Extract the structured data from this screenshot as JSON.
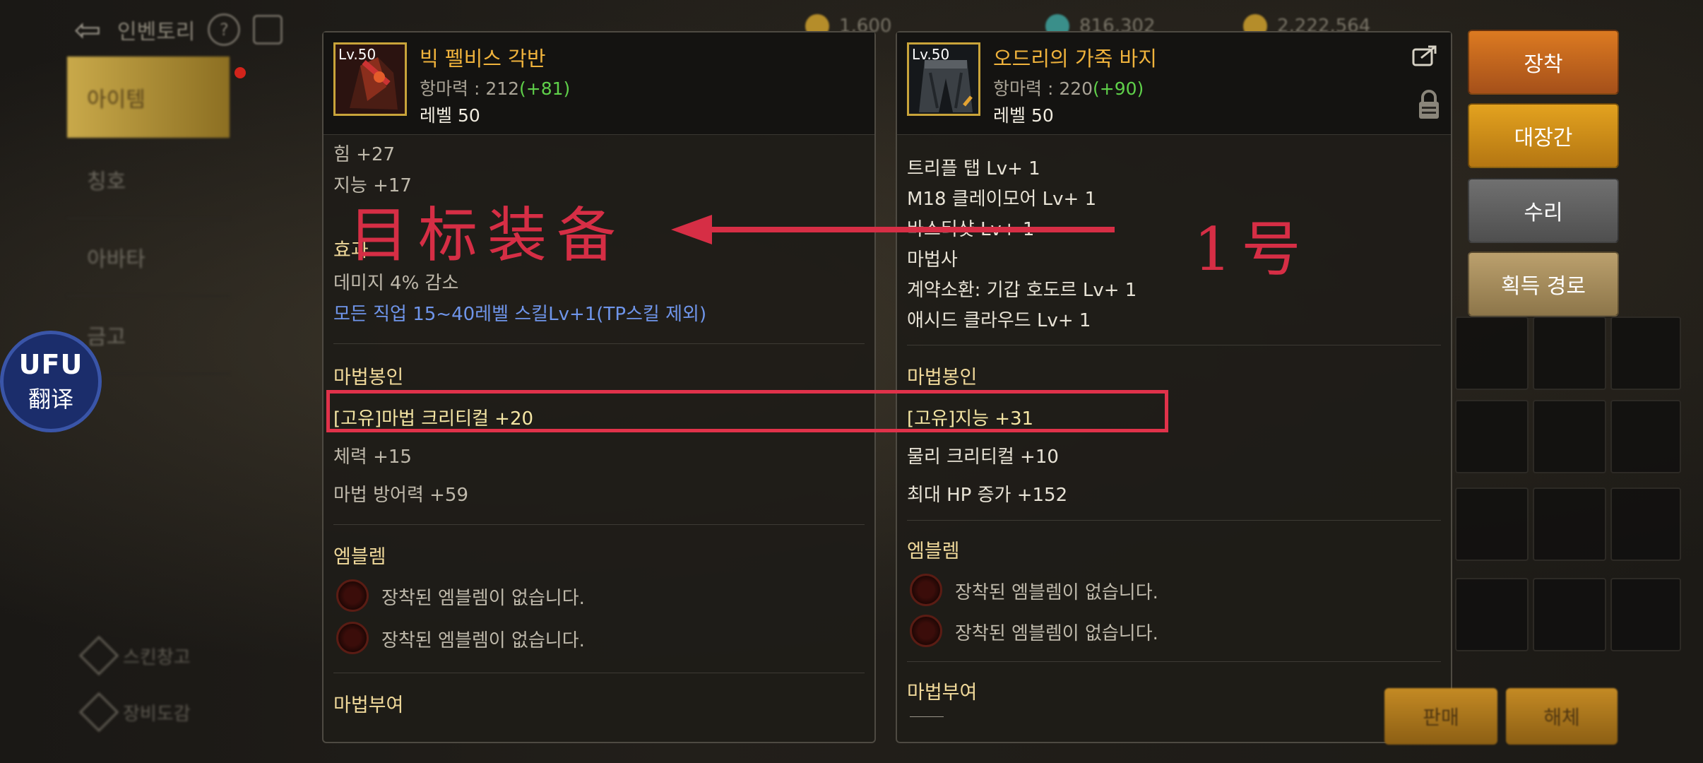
{
  "top_left": {
    "title": "인벤토리",
    "help_icon": "?"
  },
  "nav": {
    "items": [
      "아이템",
      "칭호",
      "아바타",
      "금고"
    ],
    "bottom": [
      "스킨창고",
      "장비도감"
    ]
  },
  "currencies": [
    "1,600",
    "816,302",
    "2,222,564"
  ],
  "translator": {
    "logo": "UFU",
    "label": "翻译"
  },
  "left_item": {
    "level": "Lv.50",
    "name": "빅 펠비스 각반",
    "stat_label": "항마력 : 212",
    "stat_bonus": "(+81)",
    "level_text": "레벨 50",
    "stats": [
      "힘 +27",
      "지능 +17"
    ],
    "effect_title": "효과",
    "effects": [
      "데미지 4% 감소"
    ],
    "effect_skill": "모든 직업 15~40레벨 스킬Lv+1(TP스킬 제외)",
    "seal_title": "마법봉인",
    "seals": [
      "[고유]마법 크리티컬 +20",
      "체력 +15",
      "마법 방어력 +59"
    ],
    "emblem_title": "엠블렘",
    "emblems": [
      "장착된 엠블렘이 없습니다.",
      "장착된 엠블렘이 없습니다."
    ],
    "enchant_title": "마법부여"
  },
  "right_item": {
    "level": "Lv.50",
    "name": "오드리의 가죽 바지",
    "stat_label": "항마력 : 220",
    "stat_bonus": "(+90)",
    "level_text": "레벨 50",
    "skills": [
      "트리플 탭 Lv+ 1",
      "M18 클레이모어 Lv+ 1",
      "바스티샷 Lv+ 1",
      "마법사",
      "계약소환: 기갑 호도르 Lv+ 1",
      "애시드 클라우드 Lv+ 1"
    ],
    "seal_title": "마법봉인",
    "seals": [
      "[고유]지능 +31",
      "물리 크리티컬 +10",
      "최대 HP 증가 +152"
    ],
    "emblem_title": "엠블렘",
    "emblems": [
      "장착된 엠블렘이 없습니다.",
      "장착된 엠블렘이 없습니다."
    ],
    "enchant_title": "마법부여"
  },
  "actions": {
    "equip": "장착",
    "storage": "대장간",
    "repair": "수리",
    "source": "획득 경로"
  },
  "bottom_actions": [
    "판매",
    "해체"
  ],
  "annotations": {
    "target": "目标装备",
    "number": "1号"
  }
}
